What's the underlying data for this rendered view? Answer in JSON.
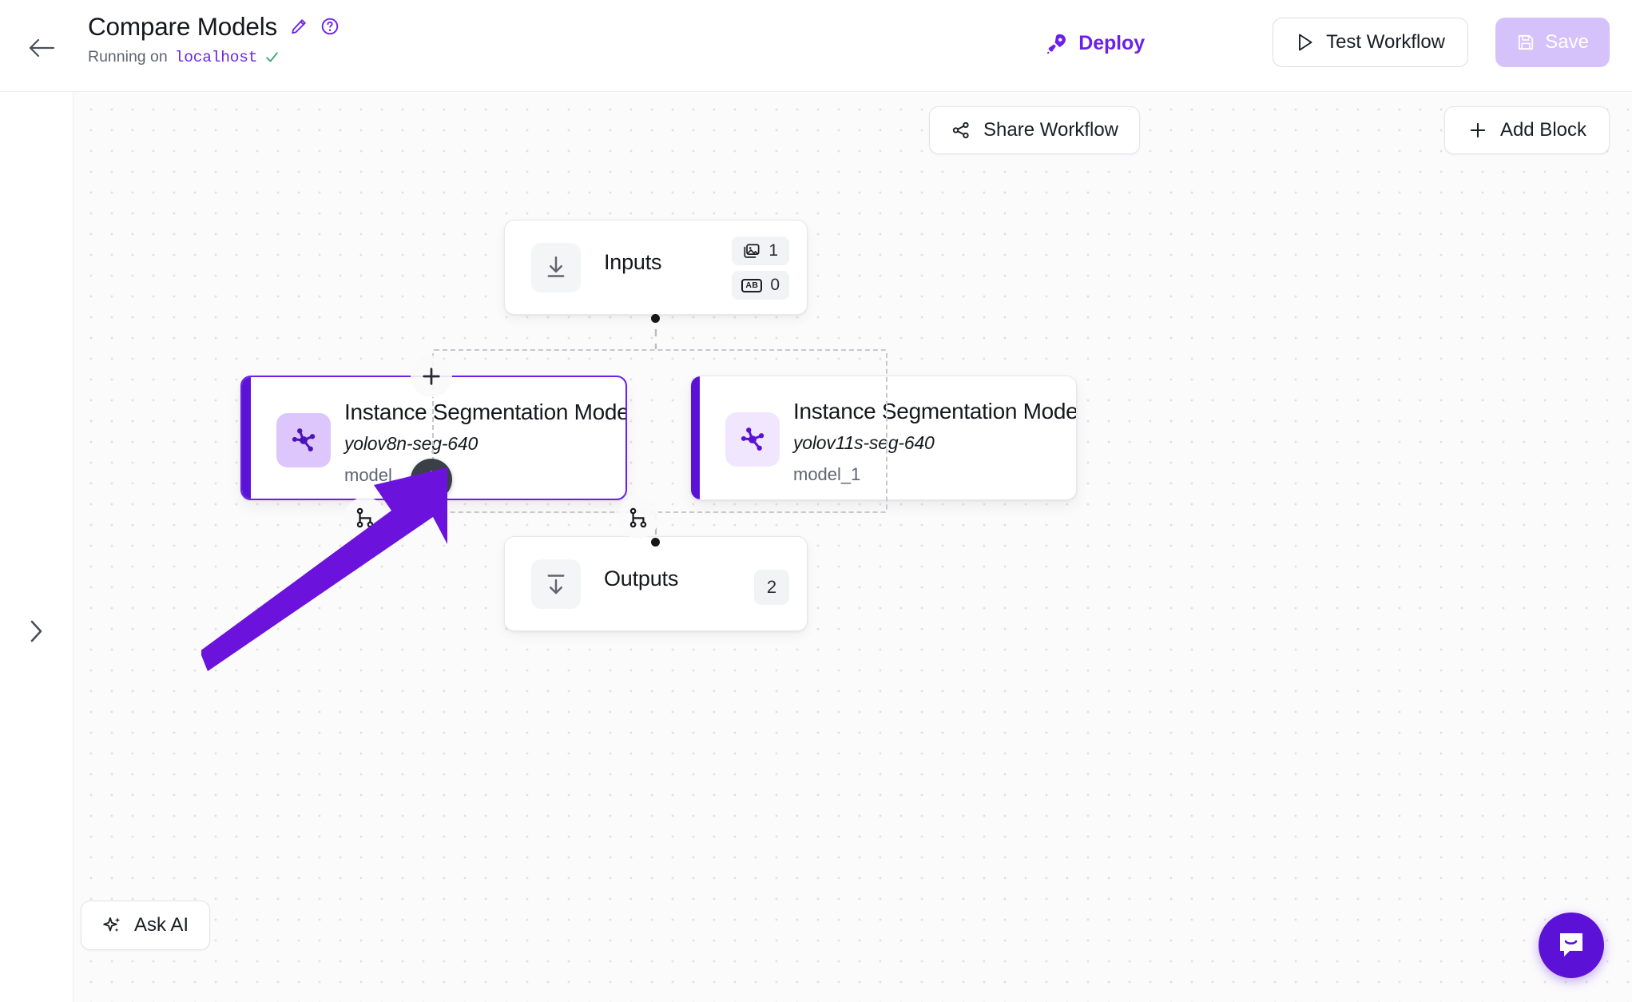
{
  "header": {
    "back_icon": "arrow-left-icon",
    "title": "Compare Models",
    "edit_icon": "pencil-icon",
    "help_icon": "question-mark-circle-icon",
    "status_prefix": "Running on",
    "status_host": "localhost",
    "status_check_icon": "check-icon",
    "deploy_label": "Deploy",
    "deploy_icon": "rocket-icon",
    "test_label": "Test Workflow",
    "test_icon": "play-icon",
    "save_label": "Save",
    "save_icon": "floppy-disk-icon",
    "save_disabled": true,
    "accent_color": "#6b21e8",
    "save_disabled_color": "#d5c2fa"
  },
  "canvas_toolbar": {
    "share_label": "Share Workflow",
    "share_icon": "share-nodes-icon",
    "add_block_label": "Add Block",
    "add_block_icon": "plus-icon"
  },
  "sidebar": {
    "expand_icon": "chevron-right-icon"
  },
  "nodes": {
    "inputs": {
      "title": "Inputs",
      "icon": "download-into-line-icon",
      "badges": [
        {
          "icon": "image-icon",
          "value": "1"
        },
        {
          "icon": "ab-text-icon",
          "label": "AB",
          "value": "0"
        }
      ]
    },
    "model_left": {
      "title": "Instance Segmentation Model",
      "subtitle": "yolov8n-seg-640",
      "slug": "model",
      "icon": "model-graph-icon",
      "selected": true,
      "accent_color": "#5b12d6",
      "left_handle_icon": "git-branch-icon",
      "right_handle_icon": "git-branch-icon",
      "top_handle_icon": "plus-icon",
      "bottom_handle_icon": "plus-icon"
    },
    "model_right": {
      "title": "Instance Segmentation Model",
      "subtitle": "yolov11s-seg-640",
      "slug": "model_1",
      "icon": "model-graph-icon",
      "selected": false,
      "accent_color": "#5b12d6"
    },
    "outputs": {
      "title": "Outputs",
      "icon": "download-out-line-icon",
      "badge_value": "2"
    }
  },
  "ask_ai": {
    "label": "Ask AI",
    "icon": "sparkles-icon"
  },
  "chat_widget": {
    "icon": "intercom-chat-icon",
    "color": "#5b12d6"
  },
  "annotation": {
    "arrow_icon": "purple-arrow-icon",
    "arrow_color": "#6b12dc",
    "points_to": "add-block-below-model-button"
  }
}
